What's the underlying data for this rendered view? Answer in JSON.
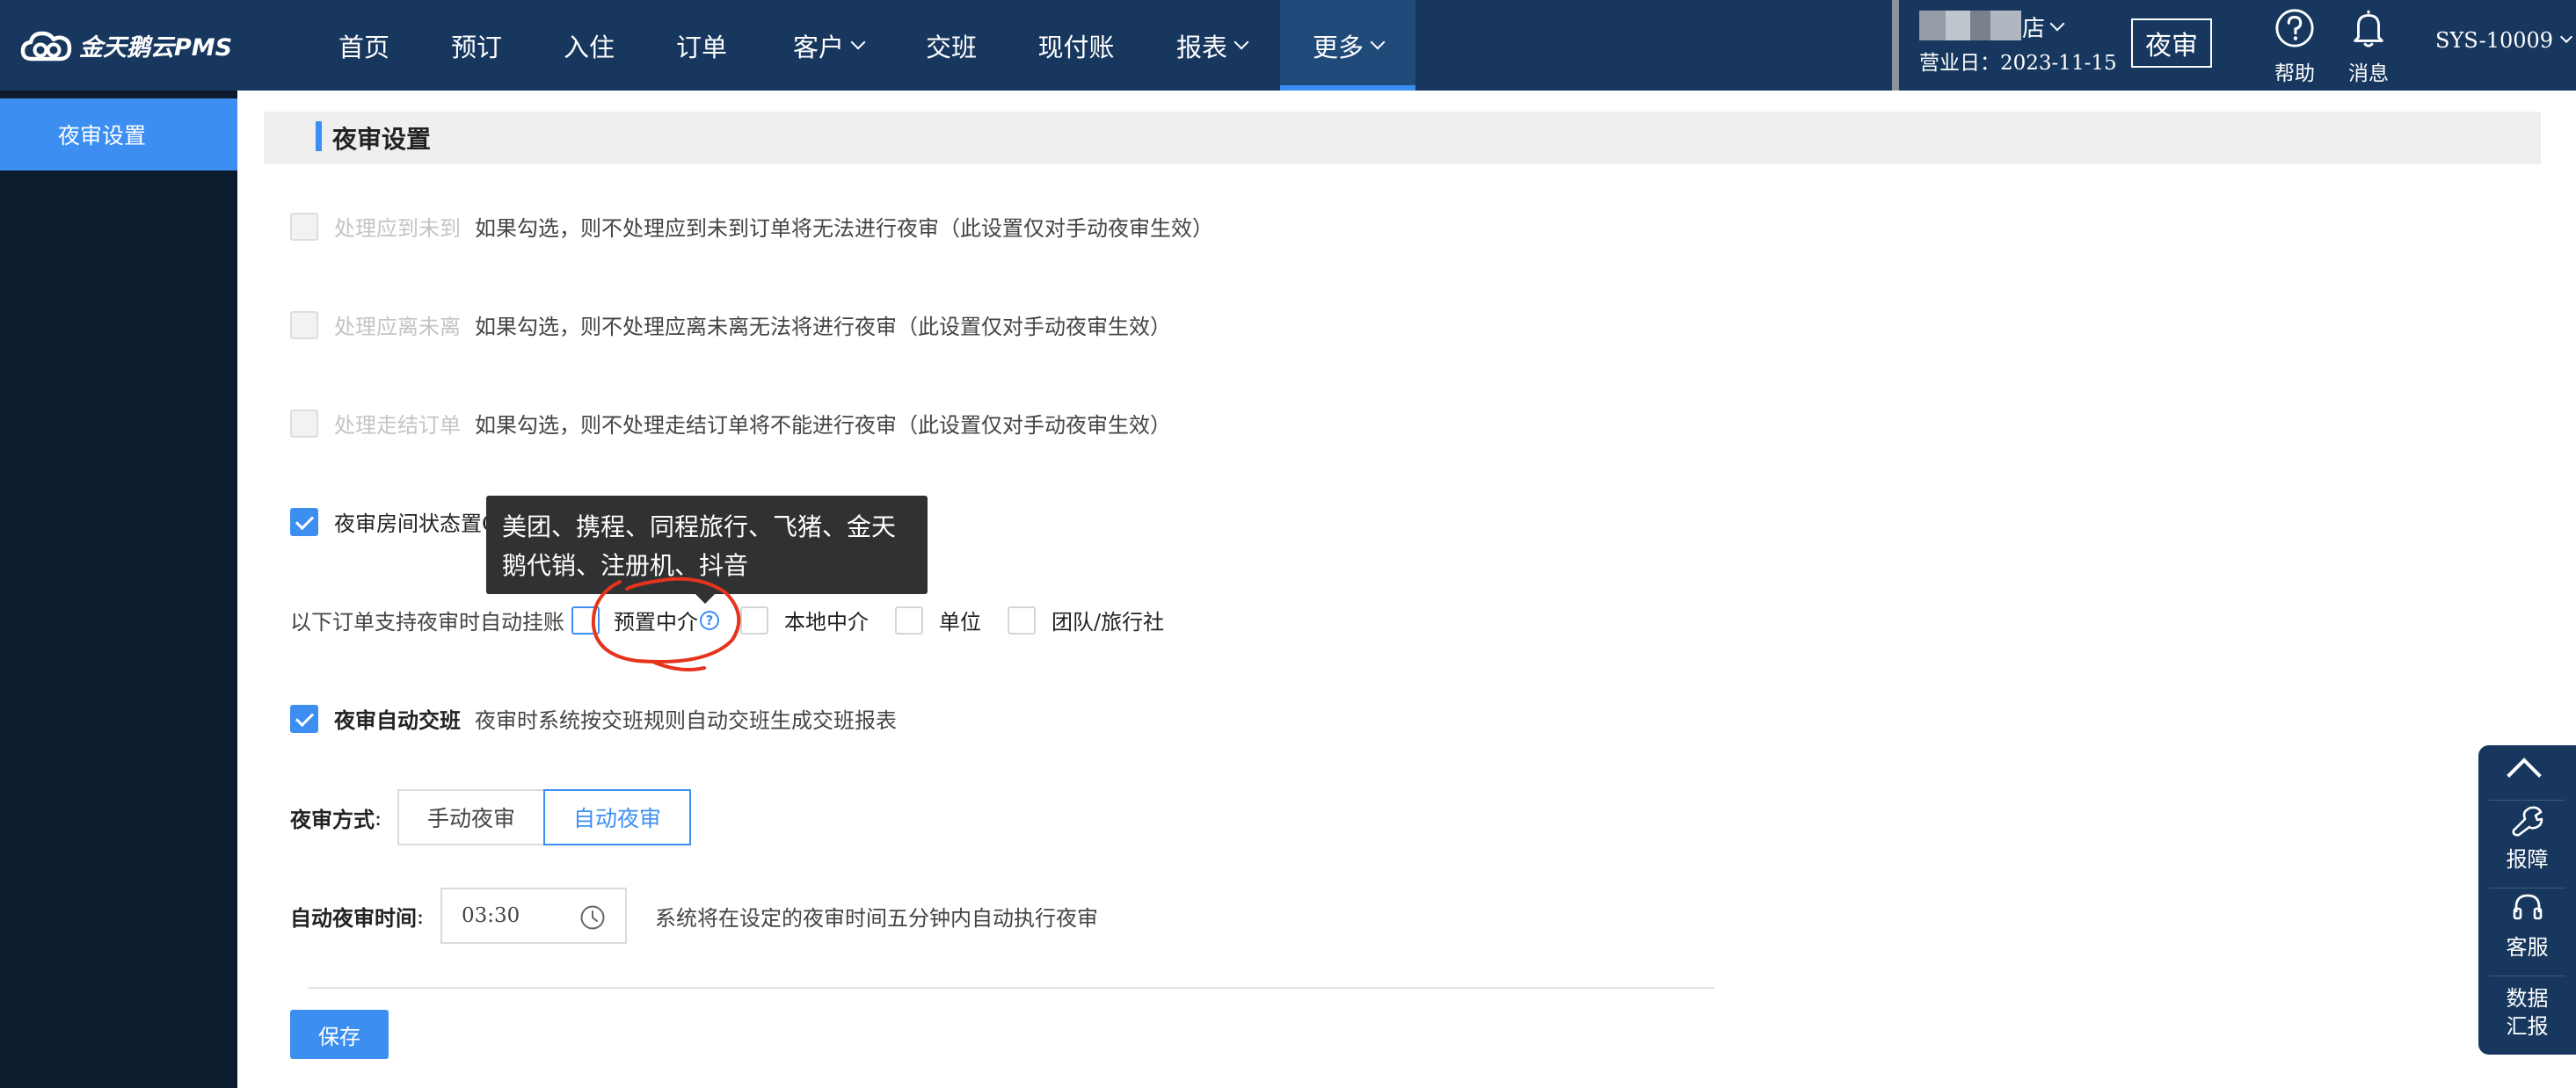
{
  "app": {
    "logo_text": "金天鹅云PMS"
  },
  "nav": {
    "items": [
      {
        "label": "首页",
        "has_caret": false,
        "active": false
      },
      {
        "label": "预订",
        "has_caret": false,
        "active": false
      },
      {
        "label": "入住",
        "has_caret": false,
        "active": false
      },
      {
        "label": "订单",
        "has_caret": false,
        "active": false
      },
      {
        "label": "客户",
        "has_caret": true,
        "active": false
      },
      {
        "label": "交班",
        "has_caret": false,
        "active": false
      },
      {
        "label": "现付账",
        "has_caret": false,
        "active": false
      },
      {
        "label": "报表",
        "has_caret": true,
        "active": false
      },
      {
        "label": "更多",
        "has_caret": true,
        "active": true
      }
    ]
  },
  "header": {
    "hotel_suffix": "店",
    "business_day_label": "营业日：",
    "business_day": "2023-11-15",
    "audit_button": "夜审",
    "help_label": "帮助",
    "messages_label": "消息",
    "user": "SYS-10009"
  },
  "sidebar": {
    "items": [
      {
        "label": "夜审设置",
        "active": true
      }
    ]
  },
  "page": {
    "title": "夜审设置",
    "options": [
      {
        "label": "处理应到未到",
        "checked": false,
        "disabled": true,
        "desc": "如果勾选，则不处理应到未到订单将无法进行夜审（此设置仅对手动夜审生效）"
      },
      {
        "label": "处理应离未离",
        "checked": false,
        "disabled": true,
        "desc": "如果勾选，则不处理应离未离无法将进行夜审（此设置仅对手动夜审生效）"
      },
      {
        "label": "处理走结订单",
        "checked": false,
        "disabled": true,
        "desc": "如果勾选，则不处理走结订单将不能进行夜审（此设置仅对手动夜审生效）"
      }
    ],
    "room_status": {
      "label": "夜审房间状态置OD",
      "checked": true
    },
    "auto_hang": {
      "label": "以下订单支持夜审时自动挂账",
      "options": [
        {
          "label": "预置中介",
          "checked": false,
          "has_help": true
        },
        {
          "label": "本地中介",
          "checked": false
        },
        {
          "label": "单位",
          "checked": false
        },
        {
          "label": "团队/旅行社",
          "checked": false
        }
      ]
    },
    "tooltip": "美团、携程、同程旅行、飞猪、金天鹅代销、注册机、抖音",
    "auto_shift": {
      "label": "夜审自动交班",
      "checked": true,
      "desc": "夜审时系统按交班规则自动交班生成交班报表"
    },
    "mode": {
      "label": "夜审方式",
      "colon": ":",
      "options": [
        "手动夜审",
        "自动夜审"
      ],
      "selected": "自动夜审"
    },
    "auto_time": {
      "label": "自动夜审时间",
      "colon": ":",
      "value": "03:30",
      "desc": "系统将在设定的夜审时间五分钟内自动执行夜审"
    },
    "save_button": "保存"
  },
  "float_panel": {
    "items": [
      {
        "label": "报障",
        "icon": "wrench-icon"
      },
      {
        "label": "客服",
        "icon": "headset-icon"
      },
      {
        "label": "数据汇报",
        "icon": ""
      }
    ]
  },
  "colors": {
    "topbar": "#17375e",
    "sidebar": "#0d1b2e",
    "accent": "#3c8ff0",
    "annotation": "#e5341b"
  }
}
